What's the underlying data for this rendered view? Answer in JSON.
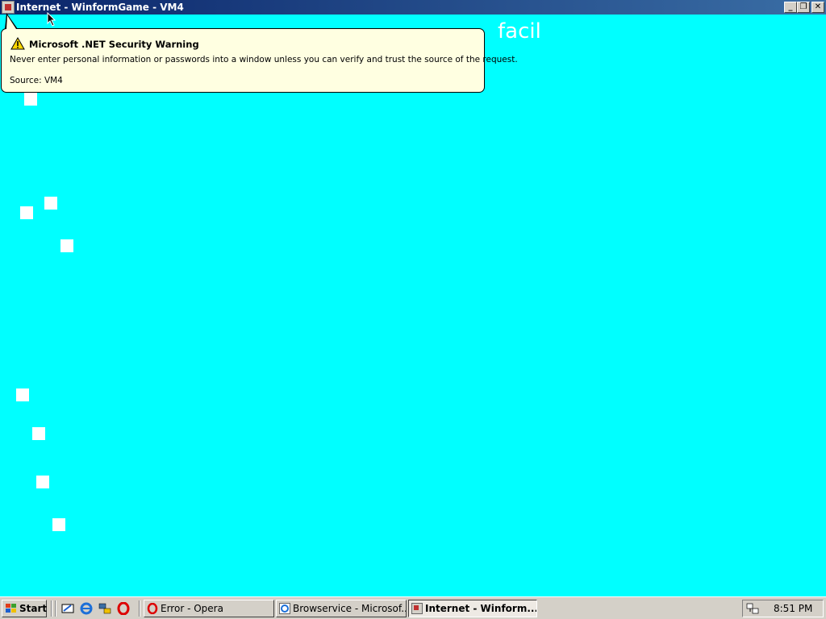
{
  "window": {
    "title": "Internet - WinformGame - VM4",
    "minimize_glyph": "_",
    "restore_glyph": "❐",
    "close_glyph": "✕"
  },
  "game": {
    "background_color": "#00ffff",
    "banner_text": "facil"
  },
  "security_balloon": {
    "title": "Microsoft .NET Security Warning",
    "message": "Never enter personal information or passwords into a window unless you can verify and trust the source of the request.",
    "source": "Source: VM4",
    "icon": "warning-icon",
    "background_color": "#ffffe1"
  },
  "taskbar": {
    "start_label": "Start",
    "quick_launch": [
      "show-desktop-icon",
      "internet-explorer-icon",
      "network-icon",
      "opera-icon"
    ],
    "tasks": [
      {
        "label": "Error - Opera",
        "icon": "opera-icon",
        "active": false
      },
      {
        "label": "Browservice - Microsof...",
        "icon": "internet-explorer-icon",
        "active": false
      },
      {
        "label": "Internet - Winform...",
        "icon": "app-window-icon",
        "active": true
      }
    ],
    "clock": "8:51 PM"
  }
}
